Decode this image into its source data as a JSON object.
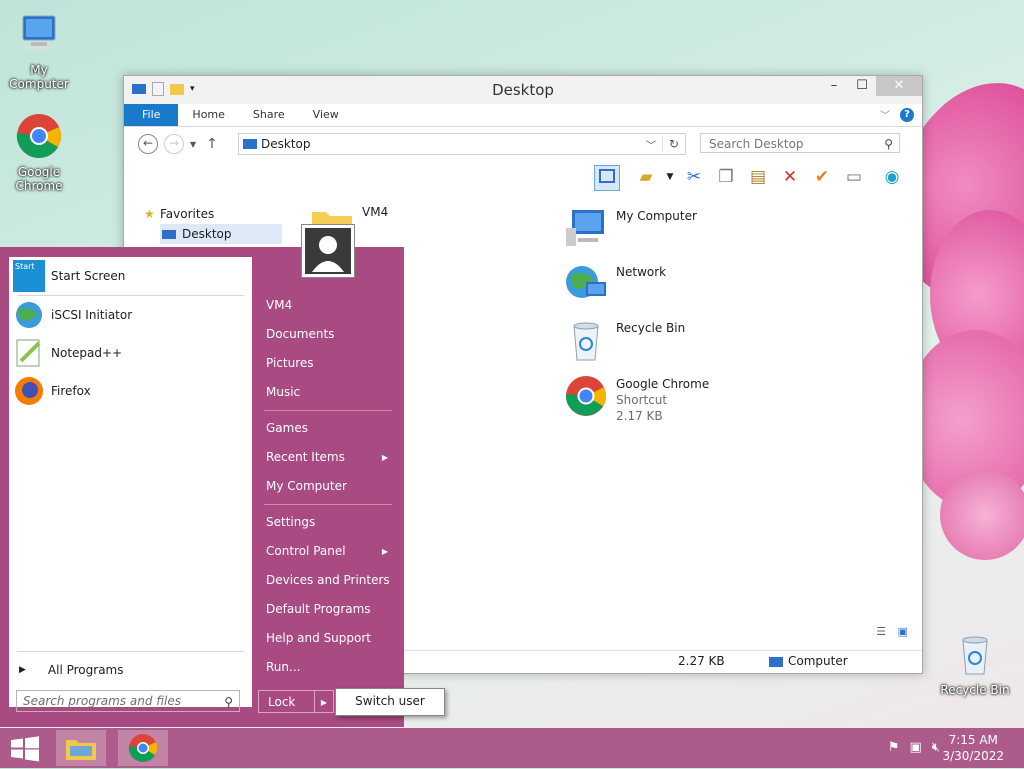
{
  "desktop": {
    "icons": [
      {
        "label": "My Computer",
        "icon": "computer-icon"
      },
      {
        "label": "Google Chrome",
        "icon": "chrome-icon"
      },
      {
        "label": "Recycle Bin",
        "icon": "recycle-bin-icon"
      }
    ]
  },
  "window": {
    "title": "Desktop",
    "ribbon_tabs": [
      "File",
      "Home",
      "Share",
      "View"
    ],
    "address": "Desktop",
    "search_placeholder": "Search Desktop",
    "navpane": {
      "favorites": "Favorites",
      "desktop": "Desktop"
    },
    "items": [
      {
        "label": "VM4",
        "icon": "folder-icon",
        "sub1": "",
        "sub2": ""
      },
      {
        "label": "My Computer",
        "icon": "computer-icon",
        "sub1": "",
        "sub2": ""
      },
      {
        "label": "Network",
        "icon": "network-icon",
        "sub1": "",
        "sub2": ""
      },
      {
        "label": "Recycle Bin",
        "icon": "recycle-bin-icon",
        "sub1": "",
        "sub2": ""
      },
      {
        "label": "Google Chrome",
        "icon": "chrome-icon",
        "sub1": "Shortcut",
        "sub2": "2.17 KB"
      }
    ],
    "status": {
      "size": "2.27 KB",
      "location": "Computer"
    }
  },
  "start_menu": {
    "programs": [
      {
        "label": "Start Screen",
        "icon": "start-screen-icon"
      },
      {
        "label": "iSCSI Initiator",
        "icon": "iscsi-icon"
      },
      {
        "label": "Notepad++",
        "icon": "notepad-icon"
      },
      {
        "label": "Firefox",
        "icon": "firefox-icon"
      }
    ],
    "all_programs": "All Programs",
    "search_placeholder": "Search programs and files",
    "right_items": [
      {
        "label": "VM4",
        "arrow": false
      },
      {
        "label": "Documents",
        "arrow": false
      },
      {
        "label": "Pictures",
        "arrow": false
      },
      {
        "label": "Music",
        "arrow": false
      },
      {
        "label": "Games",
        "arrow": false
      },
      {
        "label": "Recent Items",
        "arrow": true
      },
      {
        "label": "My Computer",
        "arrow": false
      },
      {
        "label": "Settings",
        "arrow": false
      },
      {
        "label": "Control Panel",
        "arrow": true
      },
      {
        "label": "Devices and Printers",
        "arrow": false
      },
      {
        "label": "Default Programs",
        "arrow": false
      },
      {
        "label": "Help and Support",
        "arrow": false
      },
      {
        "label": "Run...",
        "arrow": false
      }
    ],
    "lock": "Lock",
    "switch_user": "Switch user"
  },
  "taskbar": {
    "time": "7:15 AM",
    "date": "3/30/2022"
  },
  "colors": {
    "accent": "#1979ca",
    "start_bg": "#a94a83",
    "taskbar": "#ad5b8a"
  }
}
